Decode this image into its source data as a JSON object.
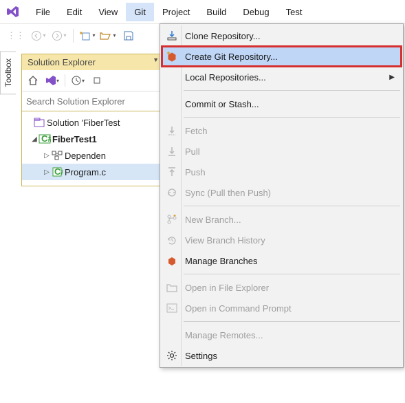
{
  "menubar": {
    "items": [
      "File",
      "Edit",
      "View",
      "Git",
      "Project",
      "Build",
      "Debug",
      "Test"
    ],
    "active_index": 3
  },
  "sidebar_tab": {
    "label": "Toolbox"
  },
  "solution_explorer": {
    "title": "Solution Explorer",
    "search_placeholder": "Search Solution Explorer",
    "tree": {
      "solution_label": "Solution 'FiberTest",
      "project_label": "FiberTest1",
      "dependencies_label": "Dependen",
      "program_label": "Program.c"
    }
  },
  "git_menu": {
    "items": [
      {
        "icon": "clone-icon",
        "label": "Clone Repository...",
        "enabled": true
      },
      {
        "icon": "create-repo-icon",
        "label": "Create Git Repository...",
        "enabled": true,
        "highlighted": true,
        "boxed": true
      },
      {
        "icon": "local-repos-icon",
        "label": "Local Repositories...",
        "enabled": true,
        "submenu": true
      },
      {
        "separator": true
      },
      {
        "icon": "commit-icon",
        "label": "Commit or Stash...",
        "enabled": true
      },
      {
        "separator": true
      },
      {
        "icon": "fetch-icon",
        "label": "Fetch",
        "enabled": false
      },
      {
        "icon": "pull-icon",
        "label": "Pull",
        "enabled": false
      },
      {
        "icon": "push-icon",
        "label": "Push",
        "enabled": false
      },
      {
        "icon": "sync-icon",
        "label": "Sync (Pull then Push)",
        "enabled": false
      },
      {
        "separator": true
      },
      {
        "icon": "new-branch-icon",
        "label": "New Branch...",
        "enabled": false
      },
      {
        "icon": "history-icon",
        "label": "View Branch History",
        "enabled": false
      },
      {
        "icon": "manage-branches-icon",
        "label": "Manage Branches",
        "enabled": true
      },
      {
        "separator": true
      },
      {
        "icon": "explorer-icon",
        "label": "Open in File Explorer",
        "enabled": false
      },
      {
        "icon": "prompt-icon",
        "label": "Open in Command Prompt",
        "enabled": false
      },
      {
        "separator": true
      },
      {
        "icon": "remotes-icon",
        "label": "Manage Remotes...",
        "enabled": false
      },
      {
        "icon": "settings-icon",
        "label": "Settings",
        "enabled": true
      }
    ]
  }
}
